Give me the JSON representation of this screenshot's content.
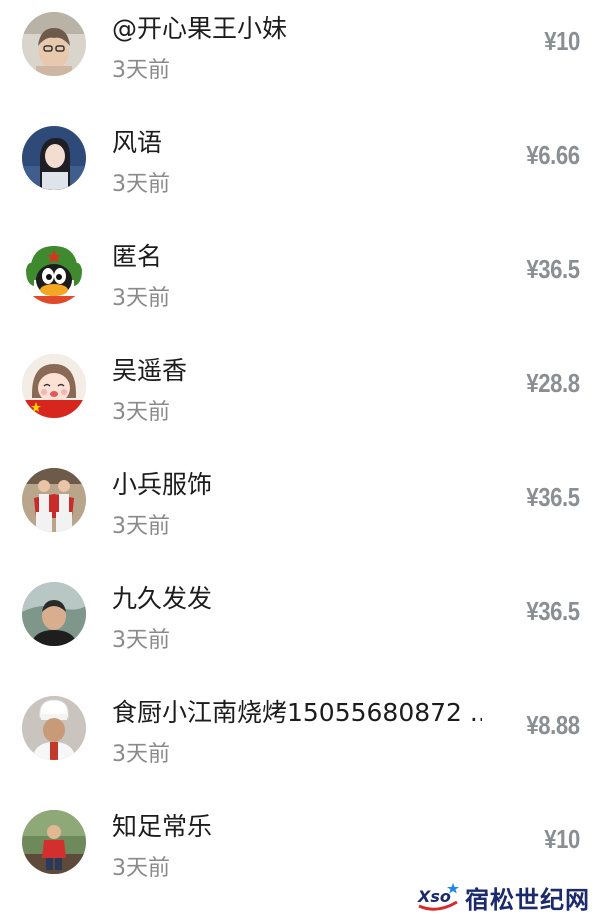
{
  "donations": [
    {
      "name": "@开心果王小妹",
      "time": "3天前",
      "amount": "¥10",
      "avatar": "girl-photo"
    },
    {
      "name": "风语",
      "time": "3天前",
      "amount": "¥6.66",
      "avatar": "woman-photo"
    },
    {
      "name": "匿名",
      "time": "3天前",
      "amount": "¥36.5",
      "avatar": "qq-penguin-soldier"
    },
    {
      "name": "吴遥香",
      "time": "3天前",
      "amount": "¥28.8",
      "avatar": "cartoon-girl-flag"
    },
    {
      "name": "小兵服饰",
      "time": "3天前",
      "amount": "¥36.5",
      "avatar": "two-kids-photo"
    },
    {
      "name": "九久发发",
      "time": "3天前",
      "amount": "¥36.5",
      "avatar": "man-photo"
    },
    {
      "name": "食厨小江南烧烤15055680872 ...",
      "time": "3天前",
      "amount": "¥8.88",
      "avatar": "chef-photo"
    },
    {
      "name": "知足常乐",
      "time": "3天前",
      "amount": "¥10",
      "avatar": "child-outdoor-photo"
    }
  ],
  "watermark": {
    "logo_text": "Xso",
    "site_name": "宿松世纪网"
  },
  "colors": {
    "name": "#1c1c1c",
    "time": "#8a8a8a",
    "amount": "#8a8f94",
    "watermark": "#1a2a6c"
  }
}
